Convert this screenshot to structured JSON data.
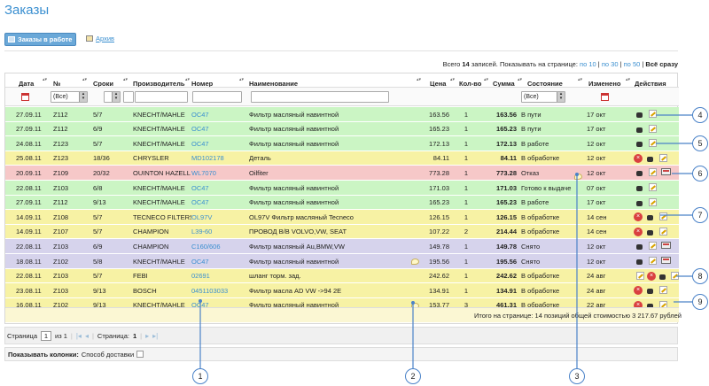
{
  "page": {
    "title": "Заказы"
  },
  "tabs": {
    "active": "Заказы в работе",
    "archive": "Архив"
  },
  "records": {
    "prefix": "Всего",
    "count": "14",
    "middle": "записей. Показывать на странице:",
    "opt10": "по 10",
    "opt30": "по 30",
    "opt50": "по 50",
    "all": "Всё сразу"
  },
  "columns": {
    "date": "Дата",
    "num": "№",
    "terms": "Сроки",
    "maker": "Производитель",
    "number": "Номер",
    "name": "Наименование",
    "price": "Цена",
    "qty": "Кол-во",
    "sum": "Сумма",
    "status": "Состояние",
    "changed": "Изменено",
    "actions": "Действия"
  },
  "filters": {
    "num_select": "(Все)",
    "status_select": "(Все)"
  },
  "rows": [
    {
      "date": "27.09.11",
      "num": "Z112",
      "terms": "5/7",
      "maker": "KNECHT/MAHLE",
      "number": "OC47",
      "name": "Фильтр масляный навинтной",
      "price": "163.56",
      "qty": "1",
      "sum": "163.56",
      "status": "В пути",
      "changed": "17 окт",
      "color": "green"
    },
    {
      "date": "27.09.11",
      "num": "Z112",
      "terms": "6/9",
      "maker": "KNECHT/MAHLE",
      "number": "OC47",
      "name": "Фильтр масляный навинтной",
      "price": "165.23",
      "qty": "1",
      "sum": "165.23",
      "status": "В пути",
      "changed": "17 окт",
      "color": "green"
    },
    {
      "date": "24.08.11",
      "num": "Z123",
      "terms": "5/7",
      "maker": "KNECHT/MAHLE",
      "number": "OC47",
      "name": "Фильтр масляный навинтной",
      "price": "172.13",
      "qty": "1",
      "sum": "172.13",
      "status": "В работе",
      "changed": "12 окт",
      "color": "green"
    },
    {
      "date": "25.08.11",
      "num": "Z123",
      "terms": "18/36",
      "maker": "CHRYSLER",
      "number": "MD102178",
      "name": "Деталь",
      "price": "84.11",
      "qty": "1",
      "sum": "84.11",
      "status": "В обработке",
      "changed": "12 окт",
      "color": "yellow"
    },
    {
      "date": "20.09.11",
      "num": "Z109",
      "terms": "20/32",
      "maker": "OUINTON HAZELL",
      "number": "WL7070",
      "name": "Oilfiter",
      "price": "773.28",
      "qty": "1",
      "sum": "773.28",
      "status": "Отказ",
      "changed": "12 окт",
      "color": "pink"
    },
    {
      "date": "22.08.11",
      "num": "Z103",
      "terms": "6/8",
      "maker": "KNECHT/MAHLE",
      "number": "OC47",
      "name": "Фильтр масляный навинтной",
      "price": "171.03",
      "qty": "1",
      "sum": "171.03",
      "status": "Готово к выдаче",
      "changed": "07 окт",
      "color": "green"
    },
    {
      "date": "27.09.11",
      "num": "Z112",
      "terms": "9/13",
      "maker": "KNECHT/MAHLE",
      "number": "OC47",
      "name": "Фильтр масляный навинтной",
      "price": "165.23",
      "qty": "1",
      "sum": "165.23",
      "status": "В работе",
      "changed": "17 окт",
      "color": "green"
    },
    {
      "date": "14.09.11",
      "num": "Z108",
      "terms": "5/7",
      "maker": "TECNECO FILTERS",
      "number": "OL97V",
      "name": "OL97V Фильтр масляный Tecneco",
      "price": "126.15",
      "qty": "1",
      "sum": "126.15",
      "status": "В обработке",
      "changed": "14 сен",
      "color": "yellow"
    },
    {
      "date": "14.09.11",
      "num": "Z107",
      "terms": "5/7",
      "maker": "CHAMPION",
      "number": "L39-60",
      "name": "ПРОВОД В/В VOLVO,VW, SEAT",
      "price": "107.22",
      "qty": "2",
      "sum": "214.44",
      "status": "В обработке",
      "changed": "14 сен",
      "color": "yellow"
    },
    {
      "date": "22.08.11",
      "num": "Z103",
      "terms": "6/9",
      "maker": "CHAMPION",
      "number": "C160/606",
      "name": "Фильтр масляный Au,BMW,VW",
      "price": "149.78",
      "qty": "1",
      "sum": "149.78",
      "status": "Снято",
      "changed": "12 окт",
      "color": "purple"
    },
    {
      "date": "18.08.11",
      "num": "Z102",
      "terms": "5/8",
      "maker": "KNECHT/MAHLE",
      "number": "OC47",
      "name": "Фильтр масляный навинтной",
      "price": "195.56",
      "qty": "1",
      "sum": "195.56",
      "status": "Снято",
      "changed": "12 окт",
      "color": "purple"
    },
    {
      "date": "22.08.11",
      "num": "Z103",
      "terms": "5/7",
      "maker": "FEBI",
      "number": "02691",
      "name": "шланг торм. зад.",
      "price": "242.62",
      "qty": "1",
      "sum": "242.62",
      "status": "В обработке",
      "changed": "24 авг",
      "color": "yellow"
    },
    {
      "date": "23.08.11",
      "num": "Z103",
      "terms": "9/13",
      "maker": "BOSCH",
      "number": "0451103033",
      "name": "Фильтр масла AD VW ->94 2E",
      "price": "134.91",
      "qty": "1",
      "sum": "134.91",
      "status": "В обработке",
      "changed": "24 авг",
      "color": "yellow"
    },
    {
      "date": "16.08.11",
      "num": "Z102",
      "terms": "9/13",
      "maker": "KNECHT/MAHLE",
      "number": "OC47",
      "name": "Фильтр масляный навинтной",
      "price": "153.77",
      "qty": "3",
      "sum": "461.31",
      "status": "В обработке",
      "changed": "22 авг",
      "color": "yellow"
    }
  ],
  "total": {
    "text": "Итого на странице: 14 позиций общей стоимостью 3 217.67 рублей"
  },
  "pager": {
    "page_label": "Страница",
    "page_value": "1",
    "of_label": "из 1",
    "page2_label": "Страница:",
    "page2_value": "1"
  },
  "columns_bar": {
    "label": "Показывать колонки:",
    "option": "Способ доставки"
  },
  "callouts": [
    "1",
    "2",
    "3",
    "4",
    "5",
    "6",
    "7",
    "8",
    "9"
  ]
}
